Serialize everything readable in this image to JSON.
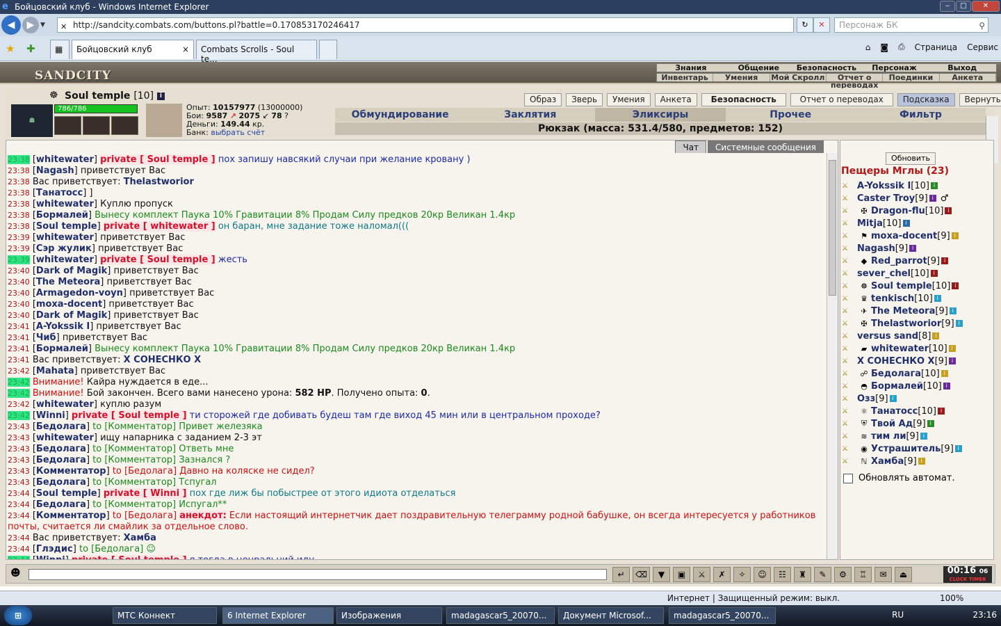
{
  "window": {
    "title": "Бойцовский клуб - Windows Internet Explorer"
  },
  "addressbar": {
    "url": "http://sandcity.combats.com/buttons.pl?battle=0.170853170246417",
    "search_placeholder": "Персонаж БК"
  },
  "tabs": [
    {
      "label": "Бойцовский клуб"
    },
    {
      "label": "Combats Scrolls - Soul te..."
    }
  ],
  "commandbar": {
    "page": "Страница",
    "tools": "Сервис"
  },
  "game": {
    "logo": "SANDCITY",
    "menu_top": [
      "Знания",
      "Общение",
      "Безопасность",
      "Персонаж",
      "Выход"
    ],
    "menu_bottom": [
      "Инвентарь",
      "Умения",
      "Мой Скролл",
      "Отчет о переводах",
      "Поединки",
      "Анкета"
    ],
    "char": {
      "name": "Soul temple",
      "level": "[10]",
      "hp": "786/786",
      "exp_label": "Опыт:",
      "exp": "10157977",
      "exp_next": "(13000000)",
      "battles_label": "Бои:",
      "battles_won": "9587",
      "battles_lost": "2075",
      "battles_draw": "78",
      "money_label": "Деньги:",
      "money": "149.44",
      "money_unit": "кр.",
      "bank_label": "Банк:",
      "bank_link": "выбрать счёт",
      "hp_fraction": 1.0
    },
    "buttons": [
      "Образ",
      "Зверь",
      "Умения",
      "Анкета",
      "Безопасность",
      "Отчет о переводах",
      "Подсказка",
      "Вернуться"
    ],
    "inv_tabs": [
      "Обмундирование",
      "Заклятия",
      "Эликсиры",
      "Прочее",
      "Фильтр"
    ],
    "backpack": "Рюкзак (масса: 531.4/580, предметов: 152)",
    "chat_tabs": [
      "Чат",
      "Системные сообщения"
    ],
    "refresh": "Обновить",
    "location": "Пещеры Мглы (23)",
    "autorefresh": "Обновлять автомат.",
    "clock": {
      "time": "00:16",
      "sec": "06",
      "l1": "CLOCK",
      "l2": "TIMER"
    }
  },
  "chat": [
    {
      "t": "23:38",
      "hl": true,
      "segs": [
        [
          "[",
          ""
        ],
        [
          "whitewater",
          "nm"
        ],
        [
          "] ",
          ""
        ],
        [
          "private [ Soul temple ]",
          "pv"
        ],
        [
          " пох запишу навсякий случаи при желание кровану )",
          "navy"
        ]
      ]
    },
    {
      "t": "23:38",
      "segs": [
        [
          "[",
          ""
        ],
        [
          "Nagash",
          "nm"
        ],
        [
          "] приветствует Вас",
          ""
        ]
      ]
    },
    {
      "t": "23:38",
      "segs": [
        [
          "Вас приветствует: ",
          ""
        ],
        [
          "Thelastworior",
          "nm"
        ]
      ]
    },
    {
      "t": "23:38",
      "segs": [
        [
          "[",
          ""
        ],
        [
          "Танатосс",
          "nm"
        ],
        [
          "] ]",
          ""
        ]
      ]
    },
    {
      "t": "23:38",
      "segs": [
        [
          "[",
          ""
        ],
        [
          "whitewater",
          "nm"
        ],
        [
          "] Куплю пропуск",
          ""
        ]
      ]
    },
    {
      "t": "23:38",
      "segs": [
        [
          "[",
          ""
        ],
        [
          "Бормалей",
          "nm"
        ],
        [
          "] ",
          ""
        ],
        [
          "Вынесу комплект Паука 10% Гравитации 8% Продам Силу предков 20кр Великан 1.4кр",
          "green"
        ]
      ]
    },
    {
      "t": "23:38",
      "segs": [
        [
          "[",
          ""
        ],
        [
          "Soul temple",
          "nm"
        ],
        [
          "] ",
          ""
        ],
        [
          "private [ whitewater ]",
          "pv"
        ],
        [
          " он баран, мне задание тоже наломал(((",
          "teal"
        ]
      ]
    },
    {
      "t": "23:39",
      "segs": [
        [
          "[",
          ""
        ],
        [
          "whitewater",
          "nm"
        ],
        [
          "] приветствует Вас",
          ""
        ]
      ]
    },
    {
      "t": "23:39",
      "segs": [
        [
          "[",
          ""
        ],
        [
          "Сэр жулик",
          "nm"
        ],
        [
          "] приветствует Вас",
          ""
        ]
      ]
    },
    {
      "t": "23:39",
      "hl": true,
      "segs": [
        [
          "[",
          ""
        ],
        [
          "whitewater",
          "nm"
        ],
        [
          "] ",
          ""
        ],
        [
          "private [ Soul temple ]",
          "pv"
        ],
        [
          " жесть",
          "navy"
        ]
      ]
    },
    {
      "t": "23:40",
      "segs": [
        [
          "[",
          ""
        ],
        [
          "Dark of Magik",
          "nm"
        ],
        [
          "] приветствует Вас",
          ""
        ]
      ]
    },
    {
      "t": "23:40",
      "segs": [
        [
          "[",
          ""
        ],
        [
          "The Meteora",
          "nm"
        ],
        [
          "] приветствует Вас",
          ""
        ]
      ]
    },
    {
      "t": "23:40",
      "segs": [
        [
          "[",
          ""
        ],
        [
          "Armagedon-voyn",
          "nm"
        ],
        [
          "] приветствует Вас",
          ""
        ]
      ]
    },
    {
      "t": "23:40",
      "segs": [
        [
          "[",
          ""
        ],
        [
          "moxa-docent",
          "nm"
        ],
        [
          "] приветствует Вас",
          ""
        ]
      ]
    },
    {
      "t": "23:40",
      "segs": [
        [
          "[",
          ""
        ],
        [
          "Dark of Magik",
          "nm"
        ],
        [
          "] приветствует Вас",
          ""
        ]
      ]
    },
    {
      "t": "23:41",
      "segs": [
        [
          "[",
          ""
        ],
        [
          "A-Yokssik I",
          "nm"
        ],
        [
          "] приветствует Вас",
          ""
        ]
      ]
    },
    {
      "t": "23:41",
      "segs": [
        [
          "[",
          ""
        ],
        [
          "Чиб",
          "nm"
        ],
        [
          "] приветствует Вас",
          ""
        ]
      ]
    },
    {
      "t": "23:41",
      "segs": [
        [
          "[",
          ""
        ],
        [
          "Бормалей",
          "nm"
        ],
        [
          "] ",
          ""
        ],
        [
          "Вынесу комплект Паука 10% Гравитации 8% Продам Силу предков 20кр Великан 1.4кр",
          "green"
        ]
      ]
    },
    {
      "t": "23:41",
      "segs": [
        [
          "Вас приветствует: ",
          ""
        ],
        [
          "X СОНЕСНКО X",
          "nm"
        ]
      ]
    },
    {
      "t": "23:42",
      "segs": [
        [
          "[",
          ""
        ],
        [
          "Mahata",
          "nm"
        ],
        [
          "] приветствует Вас",
          ""
        ]
      ]
    },
    {
      "t": "23:42",
      "hl": true,
      "segs": [
        [
          "Внимание!",
          "red"
        ],
        [
          " Кайра нуждается в еде...",
          ""
        ]
      ]
    },
    {
      "t": "23:42",
      "hl": true,
      "segs": [
        [
          "Внимание!",
          "red"
        ],
        [
          " Бой закончен. Всего вами нанесено урона: ",
          ""
        ],
        [
          "582 HP",
          "bold"
        ],
        [
          ". Получено опыта: ",
          ""
        ],
        [
          "0",
          "bold"
        ],
        [
          ".",
          ""
        ]
      ]
    },
    {
      "t": "23:42",
      "segs": [
        [
          "[",
          ""
        ],
        [
          "whitewater",
          "nm"
        ],
        [
          "] куплю разум",
          ""
        ]
      ]
    },
    {
      "t": "23:42",
      "hl": true,
      "segs": [
        [
          "[",
          ""
        ],
        [
          "Winni",
          "nm"
        ],
        [
          "] ",
          ""
        ],
        [
          "private [ Soul temple ]",
          "pv"
        ],
        [
          " ти сторожей где добивать будеш там где виход 45 мин или в центральном проходе?",
          "navy"
        ]
      ]
    },
    {
      "t": "23:43",
      "segs": [
        [
          "[",
          ""
        ],
        [
          "Бедолага",
          "nm"
        ],
        [
          "] ",
          ""
        ],
        [
          "to [Комментатор] Привет железяка",
          "green"
        ]
      ]
    },
    {
      "t": "23:43",
      "segs": [
        [
          "[",
          ""
        ],
        [
          "whitewater",
          "nm"
        ],
        [
          "] ищу напарника с заданием 2-3 эт",
          ""
        ]
      ]
    },
    {
      "t": "23:43",
      "segs": [
        [
          "[",
          ""
        ],
        [
          "Бедолага",
          "nm"
        ],
        [
          "] ",
          ""
        ],
        [
          "to [Комментатор] Ответь мне",
          "green"
        ]
      ]
    },
    {
      "t": "23:43",
      "segs": [
        [
          "[",
          ""
        ],
        [
          "Бедолага",
          "nm"
        ],
        [
          "] ",
          ""
        ],
        [
          "to [Комментатор] Зазнался ?",
          "green"
        ]
      ]
    },
    {
      "t": "23:43",
      "segs": [
        [
          "[",
          ""
        ],
        [
          "Комментатор",
          "nm"
        ],
        [
          "] ",
          ""
        ],
        [
          "to [Бедолага] Давно на коляске не сидел?",
          "red"
        ]
      ]
    },
    {
      "t": "23:43",
      "segs": [
        [
          "[",
          ""
        ],
        [
          "Бедолага",
          "nm"
        ],
        [
          "] ",
          ""
        ],
        [
          "to [Комментатор] Тспугал",
          "green"
        ]
      ]
    },
    {
      "t": "23:44",
      "segs": [
        [
          "[",
          ""
        ],
        [
          "Soul temple",
          "nm"
        ],
        [
          "] ",
          ""
        ],
        [
          "private [ Winni ]",
          "pv"
        ],
        [
          " пох где лиж бы побыстрее от этого идиота отделаться",
          "teal"
        ]
      ]
    },
    {
      "t": "23:44",
      "segs": [
        [
          "[",
          ""
        ],
        [
          "Бедолага",
          "nm"
        ],
        [
          "] ",
          ""
        ],
        [
          "to [Комментатор] Испугал**",
          "green"
        ]
      ]
    },
    {
      "t": "23:44",
      "segs": [
        [
          "[",
          ""
        ],
        [
          "Комментатор",
          "nm"
        ],
        [
          "] ",
          ""
        ],
        [
          "to [Бедолага] ",
          "red"
        ],
        [
          "анекдот:",
          "pv"
        ],
        [
          " Если настоящий интернетчик дает поздравительную телеграмму родной бабушке, он всегда интересуется у работников почты, считается ли смайлик за отдельное слово.",
          "red"
        ]
      ]
    },
    {
      "t": "23:44",
      "segs": [
        [
          "Вас приветствует: ",
          ""
        ],
        [
          "Хамба",
          "nm"
        ]
      ]
    },
    {
      "t": "23:44",
      "segs": [
        [
          "[",
          ""
        ],
        [
          "Глэдис",
          "nm"
        ],
        [
          "] ",
          ""
        ],
        [
          "to [Бедолага] ☺",
          "green"
        ]
      ]
    },
    {
      "t": "23:44",
      "hl": true,
      "segs": [
        [
          "[",
          ""
        ],
        [
          "Winni",
          "nm"
        ],
        [
          "] ",
          ""
        ],
        [
          "private [ Soul temple ]",
          "pv"
        ],
        [
          " я тогда в ценральний иду",
          "navy"
        ]
      ]
    }
  ],
  "players": [
    {
      "name": "A-Yokssik I",
      "lvl": "[10]",
      "align": "",
      "inf": "#2a8a2a"
    },
    {
      "name": "Caster Troy",
      "lvl": "[9]",
      "align": "",
      "inf": "#6a2a9a",
      "extra": "♂"
    },
    {
      "name": "Dragon-flu",
      "lvl": "[10]",
      "align": "✠",
      "inf": "#9a1a1a"
    },
    {
      "name": "Mitja",
      "lvl": "[10]",
      "align": "",
      "inf": "#2a6aa8"
    },
    {
      "name": "moxa-docent",
      "lvl": "[9]",
      "align": "⚑",
      "inf": "#c8a020"
    },
    {
      "name": "Nagash",
      "lvl": "[9]",
      "align": "",
      "inf": "#6a2a9a"
    },
    {
      "name": "Red_parrot",
      "lvl": "[9]",
      "align": "◆",
      "inf": "#9a1a1a"
    },
    {
      "name": "sever_chel",
      "lvl": "[10]",
      "align": "",
      "inf": "#9a1a1a"
    },
    {
      "name": "Soul temple",
      "lvl": "[10]",
      "align": "☸",
      "inf": "#9a1a1a"
    },
    {
      "name": "tenkisch",
      "lvl": "[10]",
      "align": "♛",
      "inf": "#2aa0c8"
    },
    {
      "name": "The Meteora",
      "lvl": "[9]",
      "align": "✈",
      "inf": "#2aa0c8"
    },
    {
      "name": "Thelastworior",
      "lvl": "[9]",
      "align": "✠",
      "inf": "#2aa0c8"
    },
    {
      "name": "versus sand",
      "lvl": "[8]",
      "align": "",
      "inf": "#c8a020"
    },
    {
      "name": "whitewater",
      "lvl": "[10]",
      "align": "▰",
      "inf": "#c8a020"
    },
    {
      "name": "X СОНЕСНКО X",
      "lvl": "[9]",
      "align": "",
      "inf": "#6a2a9a"
    },
    {
      "name": "Бедолага",
      "lvl": "[10]",
      "align": "☍",
      "inf": "#c8a020"
    },
    {
      "name": "Бормалей",
      "lvl": "[10]",
      "align": "◓",
      "inf": "#6a2a9a"
    },
    {
      "name": "Озз",
      "lvl": "[9]",
      "align": "",
      "inf": "#2aa0c8"
    },
    {
      "name": "Танатосс",
      "lvl": "[10]",
      "align": "⚛",
      "inf": "#9a1a1a"
    },
    {
      "name": "Твой Ад",
      "lvl": "[9]",
      "align": "⛨",
      "inf": "#2a8a2a"
    },
    {
      "name": "тим ли",
      "lvl": "[9]",
      "align": "≋",
      "inf": "#2aa0c8"
    },
    {
      "name": "Устрашитель",
      "lvl": "[9]",
      "align": "◉",
      "inf": "#2aa0c8"
    },
    {
      "name": "Хамба",
      "lvl": "[9]",
      "align": "ℕ",
      "inf": "#c8a020"
    }
  ],
  "status": {
    "zone": "Интернет | Защищенный режим: выкл.",
    "zoom": "100%"
  },
  "taskbar": [
    {
      "label": "МТС Коннект"
    },
    {
      "label": "6 Internet Explorer"
    },
    {
      "label": "Изображения"
    },
    {
      "label": "madagascar5_20070..."
    },
    {
      "label": "Документ Microsof..."
    },
    {
      "label": "madagascar5_20070..."
    }
  ],
  "tray": {
    "lang": "RU",
    "time": "23:16"
  }
}
